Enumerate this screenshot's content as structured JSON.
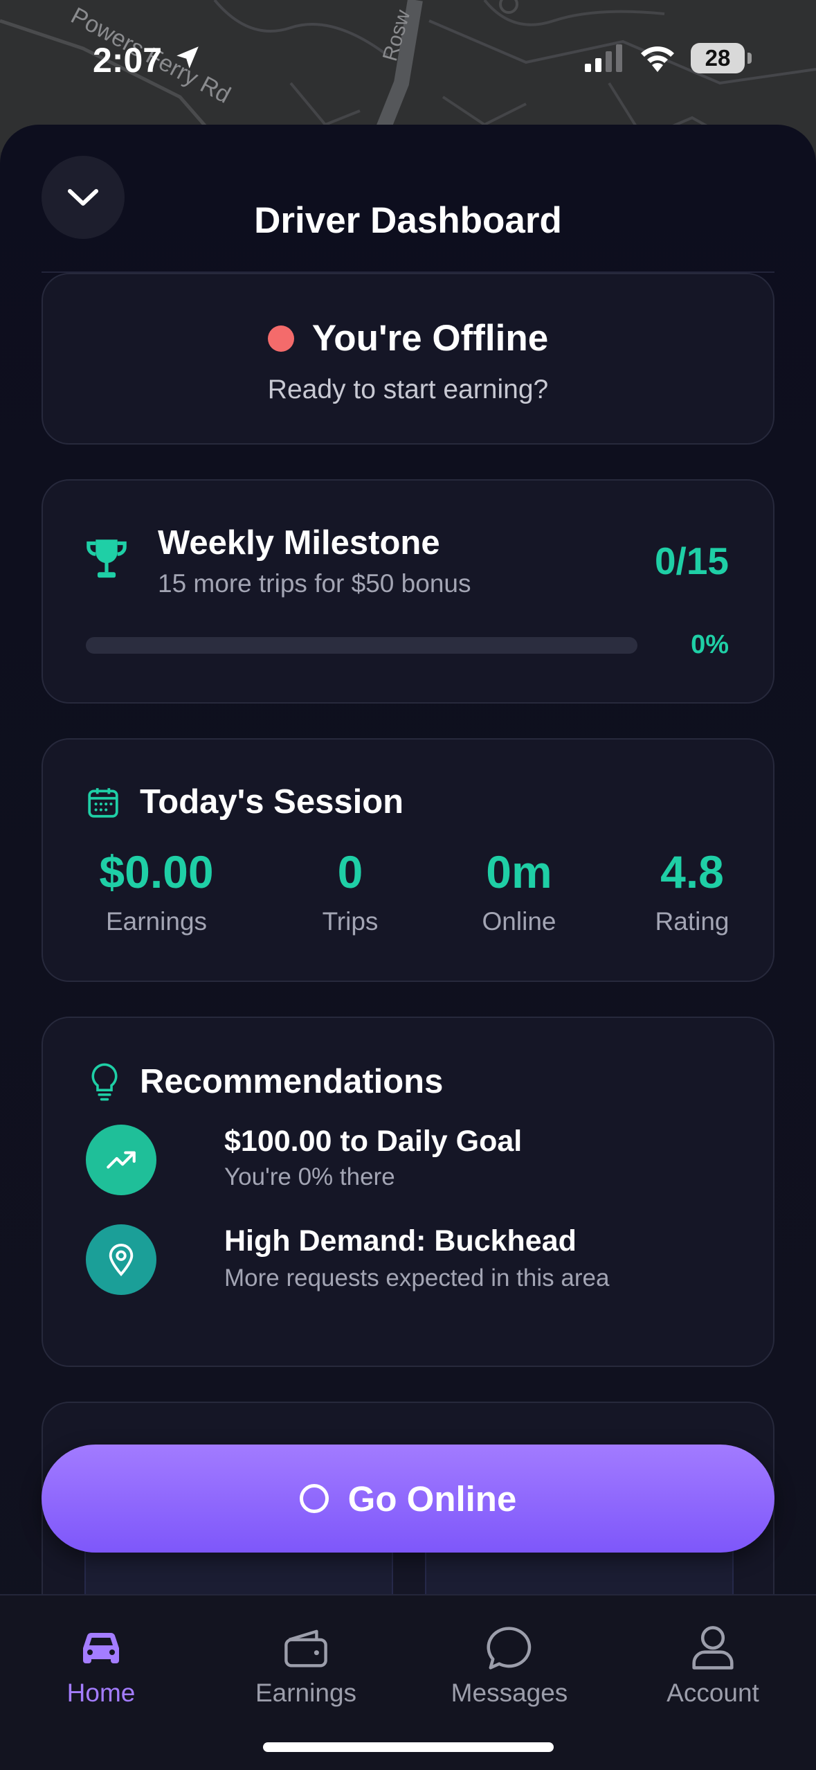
{
  "status_bar": {
    "time": "2:07",
    "battery": "28",
    "icons": [
      "location-arrow-icon",
      "cellular-signal-icon",
      "wifi-icon",
      "battery-icon"
    ]
  },
  "map": {
    "street_labels": [
      "Powers Ferry Rd",
      "Rosw"
    ]
  },
  "header": {
    "title": "Driver Dashboard",
    "collapse_icon": "chevron-down-icon"
  },
  "status_card": {
    "status": "You're Offline",
    "subtitle": "Ready to start earning?",
    "status_color": "#f46b6b"
  },
  "milestone": {
    "icon": "trophy-icon",
    "title": "Weekly Milestone",
    "subtitle": "15 more trips for $50 bonus",
    "count": "0/15",
    "percent_label": "0%",
    "progress": 0
  },
  "session": {
    "icon": "calendar-icon",
    "title": "Today's Session",
    "stats": [
      {
        "value": "$0.00",
        "label": "Earnings"
      },
      {
        "value": "0",
        "label": "Trips"
      },
      {
        "value": "0m",
        "label": "Online"
      },
      {
        "value": "4.8",
        "label": "Rating"
      }
    ]
  },
  "recommendations": {
    "icon": "lightbulb-icon",
    "title": "Recommendations",
    "items": [
      {
        "icon": "trending-up-icon",
        "title": "$100.00 to Daily Goal",
        "subtitle": "You're 0% there",
        "color": "#1fbf99"
      },
      {
        "icon": "map-pin-icon",
        "title": "High Demand: Buckhead",
        "subtitle": "More requests expected in this area",
        "color": "#1b9f98"
      }
    ]
  },
  "go_online": {
    "label": "Go Online"
  },
  "nav": {
    "items": [
      {
        "label": "Home",
        "icon": "car-icon",
        "active": true
      },
      {
        "label": "Earnings",
        "icon": "wallet-icon",
        "active": false
      },
      {
        "label": "Messages",
        "icon": "chat-bubble-icon",
        "active": false
      },
      {
        "label": "Account",
        "icon": "user-icon",
        "active": false
      }
    ]
  },
  "colors": {
    "accent_teal": "#1fcfa6",
    "accent_purple": "#8d66fc",
    "background": "#0f1020",
    "card": "#151626"
  }
}
